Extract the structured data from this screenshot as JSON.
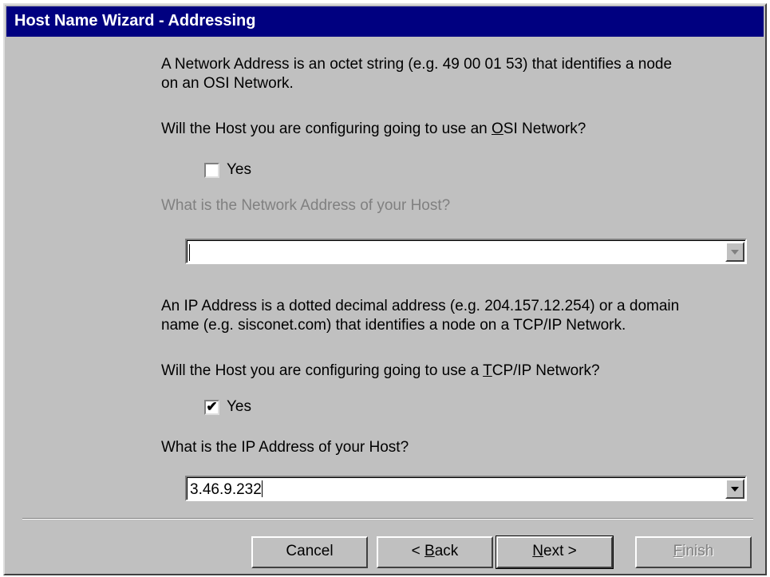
{
  "window": {
    "title": "Host Name Wizard - Addressing"
  },
  "osi": {
    "description": "A Network Address is an octet string (e.g. 49 00 01 53) that identifies a node\non an OSI Network.",
    "question_pre": "Will the Host you are configuring going to use an ",
    "question_key": "O",
    "question_post": "SI Network?",
    "checkbox_label": "Yes",
    "checked": false,
    "address_label": "What is the Network Address of your Host?",
    "address_value": ""
  },
  "ip": {
    "description": "An IP Address is a dotted decimal address (e.g. 204.157.12.254) or a domain\nname (e.g. sisconet.com) that identifies a node on a TCP/IP Network.",
    "question_pre": "Will the Host you are configuring going to use a ",
    "question_key": "T",
    "question_post": "CP/IP Network?",
    "checkbox_label": "Yes",
    "checked": true,
    "check_glyph": "✔",
    "address_label": "What is the IP Address of your Host?",
    "address_value": "3.46.9.232"
  },
  "buttons": {
    "cancel": "Cancel",
    "back_pre": "< ",
    "back_key": "B",
    "back_post": "ack",
    "next_key": "N",
    "next_post": "ext >",
    "finish_key": "F",
    "finish_post": "inish"
  },
  "colors": {
    "title_bar": "#000080",
    "face": "#c0c0c0",
    "disabled_text": "#808080"
  }
}
